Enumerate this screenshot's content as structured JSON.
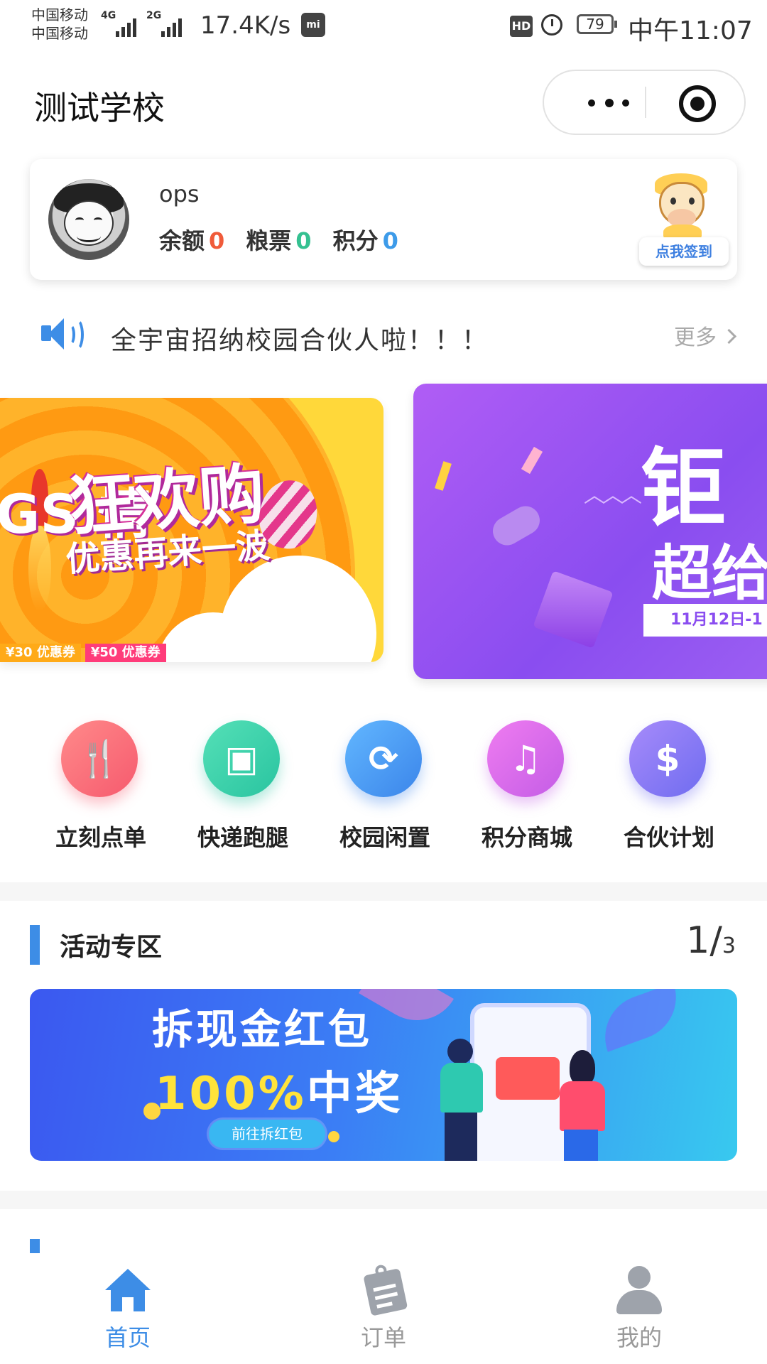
{
  "status_bar": {
    "carrier1": "中国移动",
    "carrier2": "中国移动",
    "net1": "4G",
    "net2": "2G",
    "speed": "17.4K/s",
    "hd": "HD",
    "battery": "79",
    "time": "中午11:07"
  },
  "titlebar": {
    "school_name": "测试学校"
  },
  "user": {
    "name": "ops",
    "balance_label": "余额",
    "balance_value": "0",
    "grain_label": "粮票",
    "grain_value": "0",
    "points_label": "积分",
    "points_value": "0",
    "signin_label": "点我签到"
  },
  "notice": {
    "text": "全宇宙招纳校园合伙人啦！！！",
    "more": "更多"
  },
  "banners": [
    {
      "left_text": "GS 情",
      "title": "狂欢购",
      "subtitle": "优惠再来一波",
      "coupons": [
        "¥30 优惠券",
        "¥50 优惠券"
      ]
    },
    {
      "title": "钜",
      "subtitle": "超给",
      "date": "11月12日-1"
    }
  ],
  "menu": {
    "items": [
      {
        "label": "立刻点单",
        "icon": "fork-spoon-icon",
        "color_from": "#ff8a8a",
        "color_to": "#f65a6e"
      },
      {
        "label": "快递跑腿",
        "icon": "package-icon",
        "color_from": "#55e0b7",
        "color_to": "#29c4a0"
      },
      {
        "label": "校园闲置",
        "icon": "recycle-icon",
        "color_from": "#62b7ff",
        "color_to": "#3b85ea"
      },
      {
        "label": "积分商城",
        "icon": "bell-icon",
        "color_from": "#ef7cf0",
        "color_to": "#c45de6"
      },
      {
        "label": "合伙计划",
        "icon": "dollar-icon",
        "color_from": "#a78bfa",
        "color_to": "#6f6cf0"
      }
    ]
  },
  "activity": {
    "title": "活动专区",
    "page_current": "1",
    "page_total": "3",
    "banner_line1": "拆现金红包",
    "banner_line2_yellow": "100%",
    "banner_line2_rest": "中奖",
    "banner_button": "前往拆红包"
  },
  "tabbar": {
    "items": [
      {
        "label": "首页",
        "active": true
      },
      {
        "label": "订单",
        "active": false
      },
      {
        "label": "我的",
        "active": false
      }
    ]
  },
  "colors": {
    "accent": "#3d8de6",
    "balance": "#f05b3a",
    "grain": "#35c191",
    "points": "#3d9be9"
  }
}
